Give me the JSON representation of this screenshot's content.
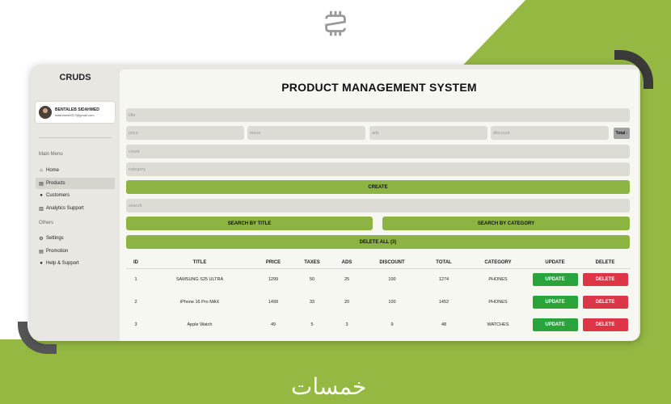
{
  "app": {
    "brand": "CRUDS",
    "page_title": "PRODUCT MANAGEMENT SYSTEM",
    "watermark": "خمسات"
  },
  "profile": {
    "name": "BENTALEB SIDAHMED",
    "email": "sidahmed0017@gmail.com"
  },
  "sidebar": {
    "main_menu_label": "Main Menu",
    "others_label": "Others",
    "main_items": [
      {
        "label": "Home",
        "icon": "home-icon"
      },
      {
        "label": "Products",
        "icon": "products-icon",
        "active": true
      },
      {
        "label": "Customers",
        "icon": "customers-icon"
      },
      {
        "label": "Analytics Support",
        "icon": "analytics-icon"
      }
    ],
    "other_items": [
      {
        "label": "Settings",
        "icon": "gear-icon"
      },
      {
        "label": "Promotion",
        "icon": "promotion-icon"
      },
      {
        "label": "Help & Support",
        "icon": "support-icon"
      }
    ]
  },
  "form": {
    "title_placeholder": "title",
    "price_placeholder": "price",
    "taxes_placeholder": "taxes",
    "ads_placeholder": "ads",
    "discount_placeholder": "discount",
    "total_label": "Total :",
    "count_placeholder": "count",
    "category_placeholder": "category",
    "create_label": "CREATE",
    "search_placeholder": "search",
    "search_title_label": "SEARCH BY TITLE",
    "search_category_label": "SEARCH BY CATEGORY",
    "delete_all_label": "DELETE ALL (3)"
  },
  "table": {
    "headers": [
      "ID",
      "TITLE",
      "PRICE",
      "TAXES",
      "ADS",
      "DISCOUNT",
      "TOTAL",
      "CATEGORY",
      "UPDATE",
      "DELETE"
    ],
    "rows": [
      {
        "id": "1",
        "title": "SAMSUNG S25 ULTRA",
        "price": "1299",
        "taxes": "50",
        "ads": "25",
        "discount": "100",
        "total": "1274",
        "category": "PHONES",
        "update": "UPDATE",
        "delete": "DELETE"
      },
      {
        "id": "2",
        "title": "iPhone 16 Pro MAX",
        "price": "1499",
        "taxes": "33",
        "ads": "20",
        "discount": "100",
        "total": "1452",
        "category": "PHONES",
        "update": "UPDATE",
        "delete": "DELETE"
      },
      {
        "id": "3",
        "title": "Apple Watch",
        "price": "49",
        "taxes": "5",
        "ads": "3",
        "discount": "9",
        "total": "48",
        "category": "WATCHES",
        "update": "UPDATE",
        "delete": "DELETE"
      }
    ]
  },
  "colors": {
    "accent_green": "#8db442",
    "background_green": "#95b843",
    "update_green": "#2aa33a",
    "delete_red": "#dc3545"
  }
}
